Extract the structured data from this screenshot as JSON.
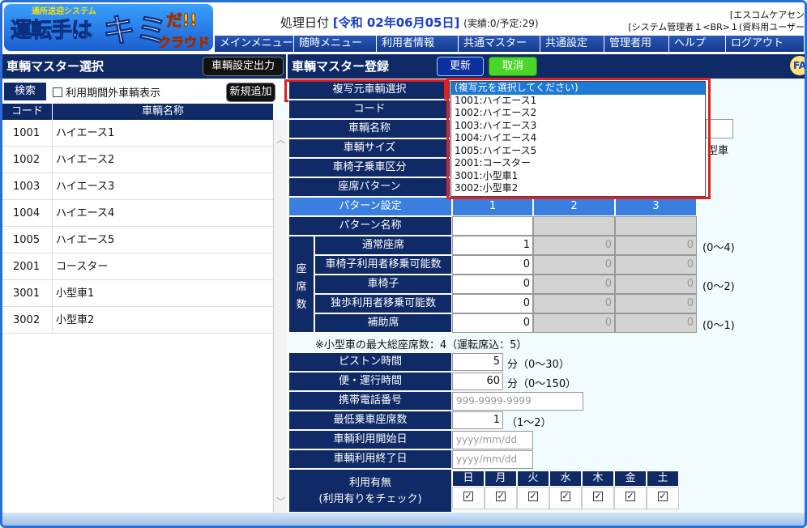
{
  "logo": {
    "sub": "通所送迎システム",
    "line1": "運転手は",
    "line2": "キミ",
    "line3": "だ!!",
    "line4": "クラウド"
  },
  "header": {
    "proc_label": "処理日付",
    "proc_date": "[令和 02年06月05日]",
    "counts": "(実績:0/予定:29)",
    "company": "[エスコムケアセン",
    "user": "[システム管理者１<BR>１(資料用ユーザー"
  },
  "menu": [
    "メインメニュー",
    "随時メニュー",
    "利用者情報",
    "共通マスター",
    "共通設定",
    "管理者用",
    "ヘルプ",
    "ログアウト"
  ],
  "left": {
    "title": "車輌マスター選択",
    "export_button": "車輌設定出力",
    "search_label": "検索",
    "out_of_period": "利用期間外車輌表示",
    "add_button": "新規追加",
    "col_code": "コード",
    "col_name": "車輌名称",
    "rows": [
      {
        "code": "1001",
        "name": "ハイエース1"
      },
      {
        "code": "1002",
        "name": "ハイエース2"
      },
      {
        "code": "1003",
        "name": "ハイエース3"
      },
      {
        "code": "1004",
        "name": "ハイエース4"
      },
      {
        "code": "1005",
        "name": "ハイエース5"
      },
      {
        "code": "2001",
        "name": "コースター"
      },
      {
        "code": "3001",
        "name": "小型車1"
      },
      {
        "code": "3002",
        "name": "小型車2"
      }
    ]
  },
  "right": {
    "title": "車輌マスター登録",
    "update_button": "更新",
    "cancel_button": "取消",
    "fa_label": "FA",
    "copy_select": "複写元車輌選択",
    "code": "コード",
    "vehicle_name": "車輌名称",
    "vehicle_size": "車輌サイズ",
    "vehicle_size_tail": "型車",
    "wheelchair_class": "車椅子乗車区分",
    "seat_pattern": "座席パターン",
    "pattern_setting": "パターン設定",
    "pattern_cols": [
      "1",
      "2",
      "3"
    ],
    "pattern_name": "パターン名称",
    "seat_group": "座席数",
    "seat_rows": [
      {
        "label": "通常座席",
        "v1": "1",
        "v2": "0",
        "v3": "0",
        "range": "(0〜4)"
      },
      {
        "label": "車椅子利用者移乗可能数",
        "v1": "0",
        "v2": "0",
        "v3": "0",
        "range": ""
      },
      {
        "label": "車椅子",
        "v1": "0",
        "v2": "0",
        "v3": "0",
        "range": "(0〜2)"
      },
      {
        "label": "独歩利用者移乗可能数",
        "v1": "0",
        "v2": "0",
        "v3": "0",
        "range": ""
      },
      {
        "label": "補助席",
        "v1": "0",
        "v2": "0",
        "v3": "0",
        "range": "(0〜1)"
      }
    ],
    "max_seat_note": "※小型車の最大総座席数：4（運転席込：5）",
    "piston_label": "ピストン時間",
    "piston_value": "5",
    "piston_unit": "分（0〜30）",
    "trip_label": "便・運行時間",
    "trip_value": "60",
    "trip_unit": "分（0〜150）",
    "phone_label": "携帯電話番号",
    "phone_placeholder": "999-9999-9999",
    "min_seat_label": "最低乗車座席数",
    "min_seat_value": "1",
    "min_seat_range": "（1〜2）",
    "start_label": "車輌利用開始日",
    "start_placeholder": "yyyy/mm/dd",
    "end_label": "車輌利用終了日",
    "end_placeholder": "yyyy/mm/dd",
    "usage_label": "利用有無",
    "usage_sub": "(利用有りをチェック)",
    "days": [
      "日",
      "月",
      "火",
      "水",
      "木",
      "金",
      "土"
    ],
    "checkmark": "✓"
  },
  "dropdown": {
    "options": [
      "(複写元を選択してください)",
      "1001:ハイエース1",
      "1002:ハイエース2",
      "1003:ハイエース3",
      "1004:ハイエース4",
      "1005:ハイエース5",
      "2001:コースター",
      "3001:小型車1",
      "3002:小型車2"
    ]
  },
  "colors": {
    "navy": "#0f2a66",
    "accent_blue": "#1e78d6",
    "highlight_red": "#e02020",
    "cancel_green": "#4bd62a"
  }
}
